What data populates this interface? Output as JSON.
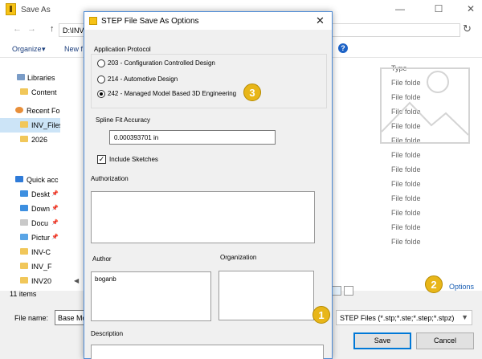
{
  "save_as": {
    "title": "Save As",
    "address": "D:\\INV",
    "toolbar": {
      "organize": "Organize",
      "new_folder": "New f"
    },
    "nav": [
      {
        "label": "Libraries"
      },
      {
        "label": "Content"
      },
      {
        "label": "Recent Fo"
      },
      {
        "label": "INV_Files"
      },
      {
        "label": "2026"
      },
      {
        "label": "Quick acc"
      },
      {
        "label": "Deskt"
      },
      {
        "label": "Down"
      },
      {
        "label": "Docu"
      },
      {
        "label": "Pictur"
      },
      {
        "label": "INV-C"
      },
      {
        "label": "INV_F"
      },
      {
        "label": "INV20"
      }
    ],
    "column_type": "Type",
    "type_cells": [
      "File folde",
      "File folde",
      "File folde",
      "File folde",
      "File folde",
      "File folde",
      "File folde",
      "File folde",
      "File folde",
      "File folde",
      "File folde",
      "File folde"
    ],
    "status": "11 items",
    "options_link": "Options",
    "file_name_label": "File name:",
    "file_name_value": "Base Mo",
    "file_type_value": "STEP Files (*.stp;*.ste;*.step;*.stpz)",
    "save_button": "Save",
    "cancel_button": "Cancel"
  },
  "badges": {
    "one": "1",
    "two": "2",
    "three": "3"
  },
  "dialog": {
    "title": "STEP File Save As Options",
    "protocol_label": "Application Protocol",
    "protocols": [
      {
        "label": "203 - Configuration Controlled Design",
        "checked": false
      },
      {
        "label": "214 - Automotive Design",
        "checked": false
      },
      {
        "label": "242 - Managed Model Based 3D Engineering",
        "checked": true
      }
    ],
    "spline_label": "Spline Fit Accuracy",
    "spline_value": "0.000393701 in",
    "include_sketches_label": "Include Sketches",
    "include_sketches_checked": true,
    "authorization_label": "Authorization",
    "author_label": "Author",
    "author_value": "boganb",
    "organization_label": "Organization",
    "description_label": "Description"
  },
  "colors": {
    "accent": "#0078d7",
    "badge": "#e8b619",
    "link": "#1a5fb4",
    "selection": "#cce4f7"
  }
}
